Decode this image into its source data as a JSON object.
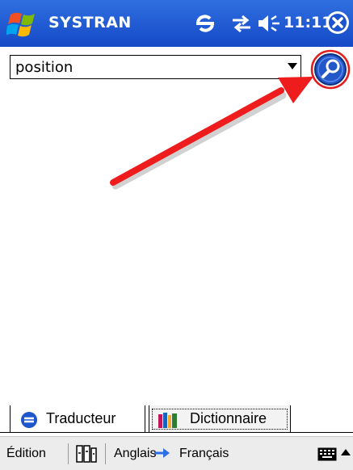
{
  "titlebar": {
    "app_title": "SYSTRAN",
    "time": "11:11"
  },
  "search": {
    "value": "position"
  },
  "tabs": [
    {
      "label": "Traducteur",
      "icon": "systran-logo-icon",
      "selected": false
    },
    {
      "label": "Dictionnaire",
      "icon": "books-icon",
      "selected": true
    }
  ],
  "menubar": {
    "edit": "Édition",
    "source_lang": "Anglais",
    "target_lang": "Français"
  },
  "colors": {
    "titlebar_blue": "#1f5ad6",
    "annotation_red": "#ee1c1c",
    "lang_arrow_blue": "#2e6fe6"
  },
  "icons": [
    "windows-flag-icon",
    "sync-icon",
    "connectivity-icon",
    "speaker-icon",
    "close-icon",
    "search-icon",
    "keyboard-icon"
  ]
}
